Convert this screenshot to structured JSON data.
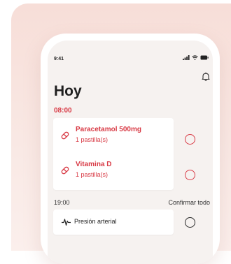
{
  "status_bar": {
    "time": "9:41"
  },
  "header": {
    "title": "Hoy"
  },
  "schedule": [
    {
      "time": "08:00",
      "items": [
        {
          "name": "Paracetamol 500mg",
          "dose": "1 pastilla(s)",
          "icon": "pill-icon"
        },
        {
          "name": "Vitamina D",
          "dose": "1 pastilla(s)",
          "icon": "pill-icon"
        }
      ]
    },
    {
      "time": "19:00",
      "action_label": "Confirmar todo",
      "items": [
        {
          "name": "Presión arterial",
          "icon": "heartbeat-icon"
        }
      ]
    }
  ],
  "colors": {
    "accent": "#d83a45",
    "background_tint": "#f7ded8"
  }
}
